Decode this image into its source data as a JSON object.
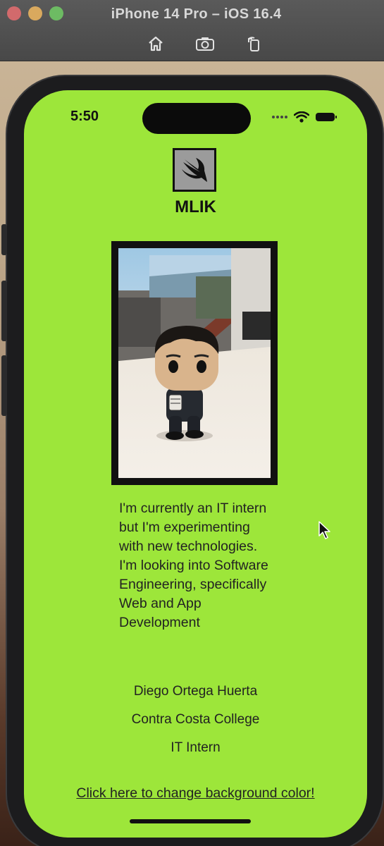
{
  "simulator": {
    "title": "iPhone 14 Pro – iOS 16.4",
    "tools": [
      {
        "icon": "home-icon"
      },
      {
        "icon": "screenshot-icon"
      },
      {
        "icon": "rotate-icon"
      }
    ]
  },
  "status_bar": {
    "time": "5:50",
    "icons": [
      "wifi-icon",
      "battery-icon"
    ]
  },
  "app": {
    "logo_icon": "swift-logo-icon",
    "brand": "MLIK",
    "bio": "I'm currently an IT intern but I'm experimenting with new technologies. I'm looking into Software Engineering, specifically Web and App Development",
    "name": "Diego Ortega Huerta",
    "school": "Contra Costa College",
    "role": "IT Intern",
    "link": "Click here to change background color!",
    "background_color": "#9de63a"
  }
}
